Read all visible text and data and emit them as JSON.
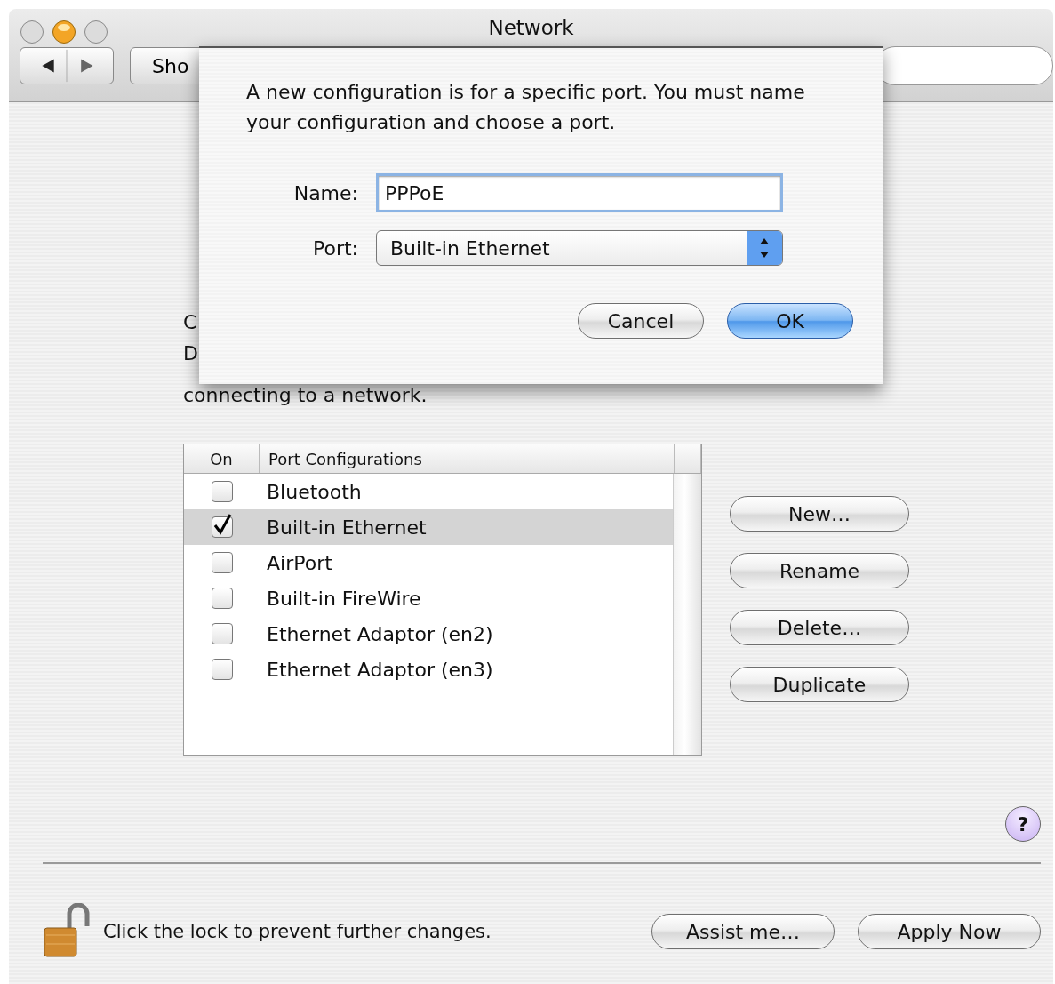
{
  "window": {
    "title": "Network"
  },
  "toolbar": {
    "show_all_button": "Sho"
  },
  "instructions": [
    "C",
    "D",
    "connecting to a network."
  ],
  "table": {
    "columns": [
      "On",
      "Port Configurations"
    ],
    "rows": [
      {
        "name": "Bluetooth",
        "checked": false,
        "selected": false
      },
      {
        "name": "Built-in Ethernet",
        "checked": true,
        "selected": true
      },
      {
        "name": "AirPort",
        "checked": false,
        "selected": false
      },
      {
        "name": "Built-in FireWire",
        "checked": false,
        "selected": false
      },
      {
        "name": "Ethernet Adaptor (en2)",
        "checked": false,
        "selected": false
      },
      {
        "name": "Ethernet Adaptor (en3)",
        "checked": false,
        "selected": false
      }
    ]
  },
  "side_buttons": [
    "New…",
    "Rename",
    "Delete…",
    "Duplicate"
  ],
  "help_button": "?",
  "lock": {
    "text": "Click the lock to prevent further changes.",
    "locked": false
  },
  "footer_buttons": [
    "Assist me…",
    "Apply Now"
  ],
  "sheet": {
    "message": "A new configuration is for a specific port. You must name your configuration and choose a port.",
    "name_label": "Name:",
    "name_value": "PPPoE",
    "port_label": "Port:",
    "port_value": "Built-in Ethernet",
    "buttons": [
      {
        "label": "Cancel",
        "default": false
      },
      {
        "label": "OK",
        "default": true
      }
    ]
  }
}
